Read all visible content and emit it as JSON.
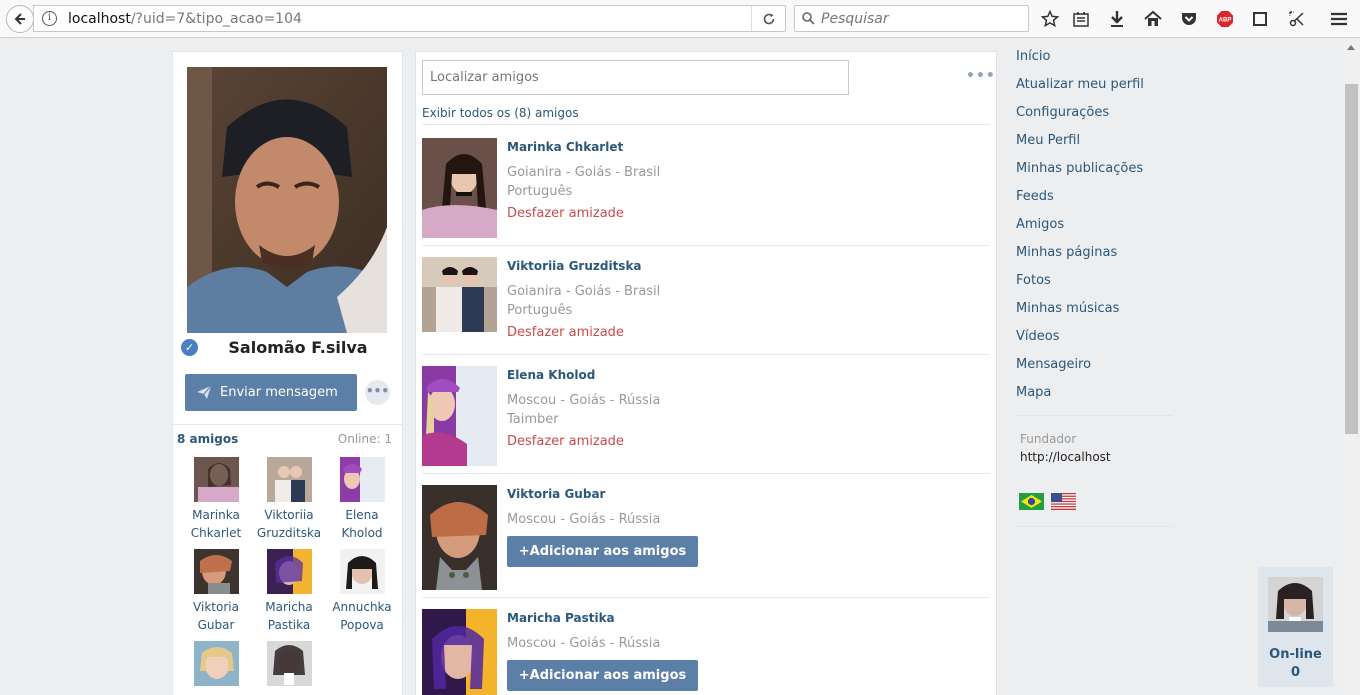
{
  "browser": {
    "url_host": "localhost",
    "url_path": "/?uid=7&tipo_acao=104",
    "search_placeholder": "Pesquisar",
    "abp_label": "ABP"
  },
  "profile": {
    "name": "Salomão F.silva",
    "message_button": "Enviar mensagem",
    "more": "•••",
    "friends_count": "8 amigos",
    "online": "Online: 1",
    "friend_tiles": [
      {
        "first": "Marinka",
        "last": "Chkarlet"
      },
      {
        "first": "Viktoriia",
        "last": "Gruzditska"
      },
      {
        "first": "Elena",
        "last": "Kholod"
      },
      {
        "first": "Viktoria",
        "last": "Gubar"
      },
      {
        "first": "Maricha",
        "last": "Pastika"
      },
      {
        "first": "Annuchka",
        "last": "Popova"
      },
      {
        "first": "",
        "last": ""
      },
      {
        "first": "",
        "last": ""
      }
    ]
  },
  "center": {
    "search_placeholder": "Localizar amigos",
    "more": "•••",
    "show_all": "Exibir todos os (8) amigos",
    "friends": [
      {
        "name": "Marinka Chkarlet",
        "location": "Goianira - Goiás - Brasil",
        "language": "Português",
        "action": "Desfazer amizade"
      },
      {
        "name": "Viktoriia Gruzditska",
        "location": "Goianira - Goiás - Brasil",
        "language": "Português",
        "action": "Desfazer amizade"
      },
      {
        "name": "Elena Kholod",
        "location": "Moscou - Goiás - Rússia",
        "language": "Taimber",
        "action": "Desfazer amizade"
      },
      {
        "name": "Viktoria Gubar",
        "location": "Moscou - Goiás - Rússia",
        "add": "+Adicionar aos amigos"
      },
      {
        "name": "Maricha Pastika",
        "location": "Moscou - Goiás - Rússia",
        "add": "+Adicionar aos amigos"
      }
    ]
  },
  "menu": {
    "items": [
      "Início",
      "Atualizar meu perfil",
      "Configurações",
      "Meu Perfil",
      "Minhas publicações",
      "Feeds",
      "Amigos",
      "Minhas páginas",
      "Fotos",
      "Minhas músicas",
      "Vídeos",
      "Mensageiro",
      "Mapa"
    ],
    "founder_label": "Fundador",
    "founder_url": "http://localhost"
  },
  "online_widget": {
    "label": "On-line",
    "count": "0"
  },
  "colors": {
    "link": "#2b587a",
    "button": "#5b7fa6",
    "unfriend": "#c84a4a",
    "page_bg": "#edeef0"
  }
}
